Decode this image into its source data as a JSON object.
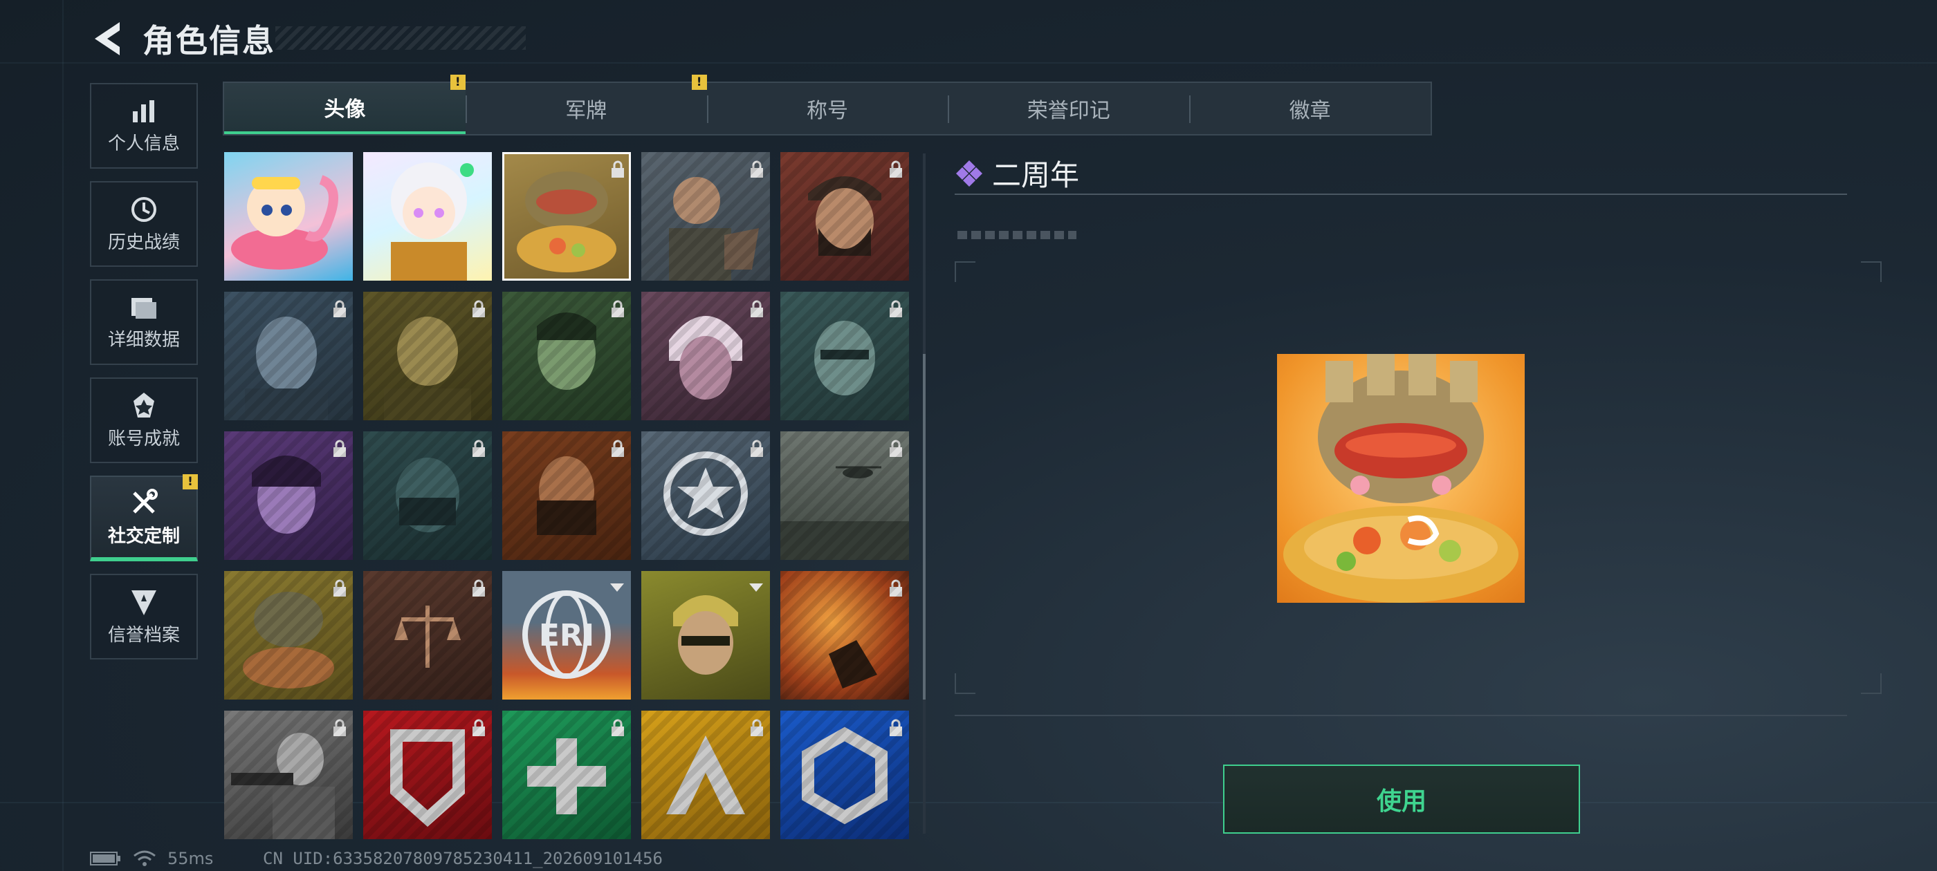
{
  "header": {
    "title": "角色信息"
  },
  "sidebar": {
    "items": [
      {
        "label": "个人信息",
        "icon": "bar-chart-icon"
      },
      {
        "label": "历史战绩",
        "icon": "clock-history-icon"
      },
      {
        "label": "详细数据",
        "icon": "folder-data-icon"
      },
      {
        "label": "账号成就",
        "icon": "achievement-icon"
      },
      {
        "label": "社交定制",
        "icon": "tools-icon",
        "badge": "!"
      },
      {
        "label": "信誉档案",
        "icon": "reputation-icon"
      }
    ]
  },
  "tabs": [
    {
      "label": "头像",
      "badge": "!"
    },
    {
      "label": "军牌",
      "badge": "!"
    },
    {
      "label": "称号"
    },
    {
      "label": "荣誉印记"
    },
    {
      "label": "徽章"
    }
  ],
  "detail": {
    "name": "二周年",
    "use_label": "使用"
  },
  "avatars": [
    {
      "name": "summer-flamingo-avatar",
      "locked": false
    },
    {
      "name": "chibi-white-hair-avatar",
      "locked": false
    },
    {
      "name": "anniversary-hotpot-avatar",
      "locked": true,
      "selected": true
    },
    {
      "name": "soldier-with-dog-avatar",
      "locked": true
    },
    {
      "name": "bearded-operator-avatar",
      "locked": true
    },
    {
      "name": "female-pilot-avatar",
      "locked": true
    },
    {
      "name": "bald-operator-avatar",
      "locked": true
    },
    {
      "name": "headset-operator-avatar",
      "locked": true
    },
    {
      "name": "white-hair-operator-avatar",
      "locked": true
    },
    {
      "name": "glasses-operator-avatar",
      "locked": true
    },
    {
      "name": "purple-operator-avatar",
      "locked": true
    },
    {
      "name": "masked-operator-avatar",
      "locked": true
    },
    {
      "name": "scarf-operator-avatar",
      "locked": true
    },
    {
      "name": "star-emblem-avatar",
      "locked": true
    },
    {
      "name": "helicopter-landscape-avatar",
      "locked": true
    },
    {
      "name": "ramen-soldier-avatar",
      "locked": true
    },
    {
      "name": "scales-emblem-avatar",
      "locked": true
    },
    {
      "name": "eri-globe-avatar",
      "locked": false,
      "text": "ERI"
    },
    {
      "name": "glasses-blonde-avatar",
      "locked": false
    },
    {
      "name": "explosion-avatar",
      "locked": true
    },
    {
      "name": "gunner-sketch-avatar",
      "locked": true
    },
    {
      "name": "red-shield-emblem-avatar",
      "locked": true
    },
    {
      "name": "green-cross-emblem-avatar",
      "locked": true
    },
    {
      "name": "yellow-a-emblem-avatar",
      "locked": true
    },
    {
      "name": "blue-hex-emblem-avatar",
      "locked": true
    }
  ],
  "status": {
    "ping": "55ms",
    "uid": "CN UID:63358207809785230411_202609101456"
  },
  "colors": {
    "accent": "#3fcf8e",
    "badge": "#e8c23c"
  }
}
